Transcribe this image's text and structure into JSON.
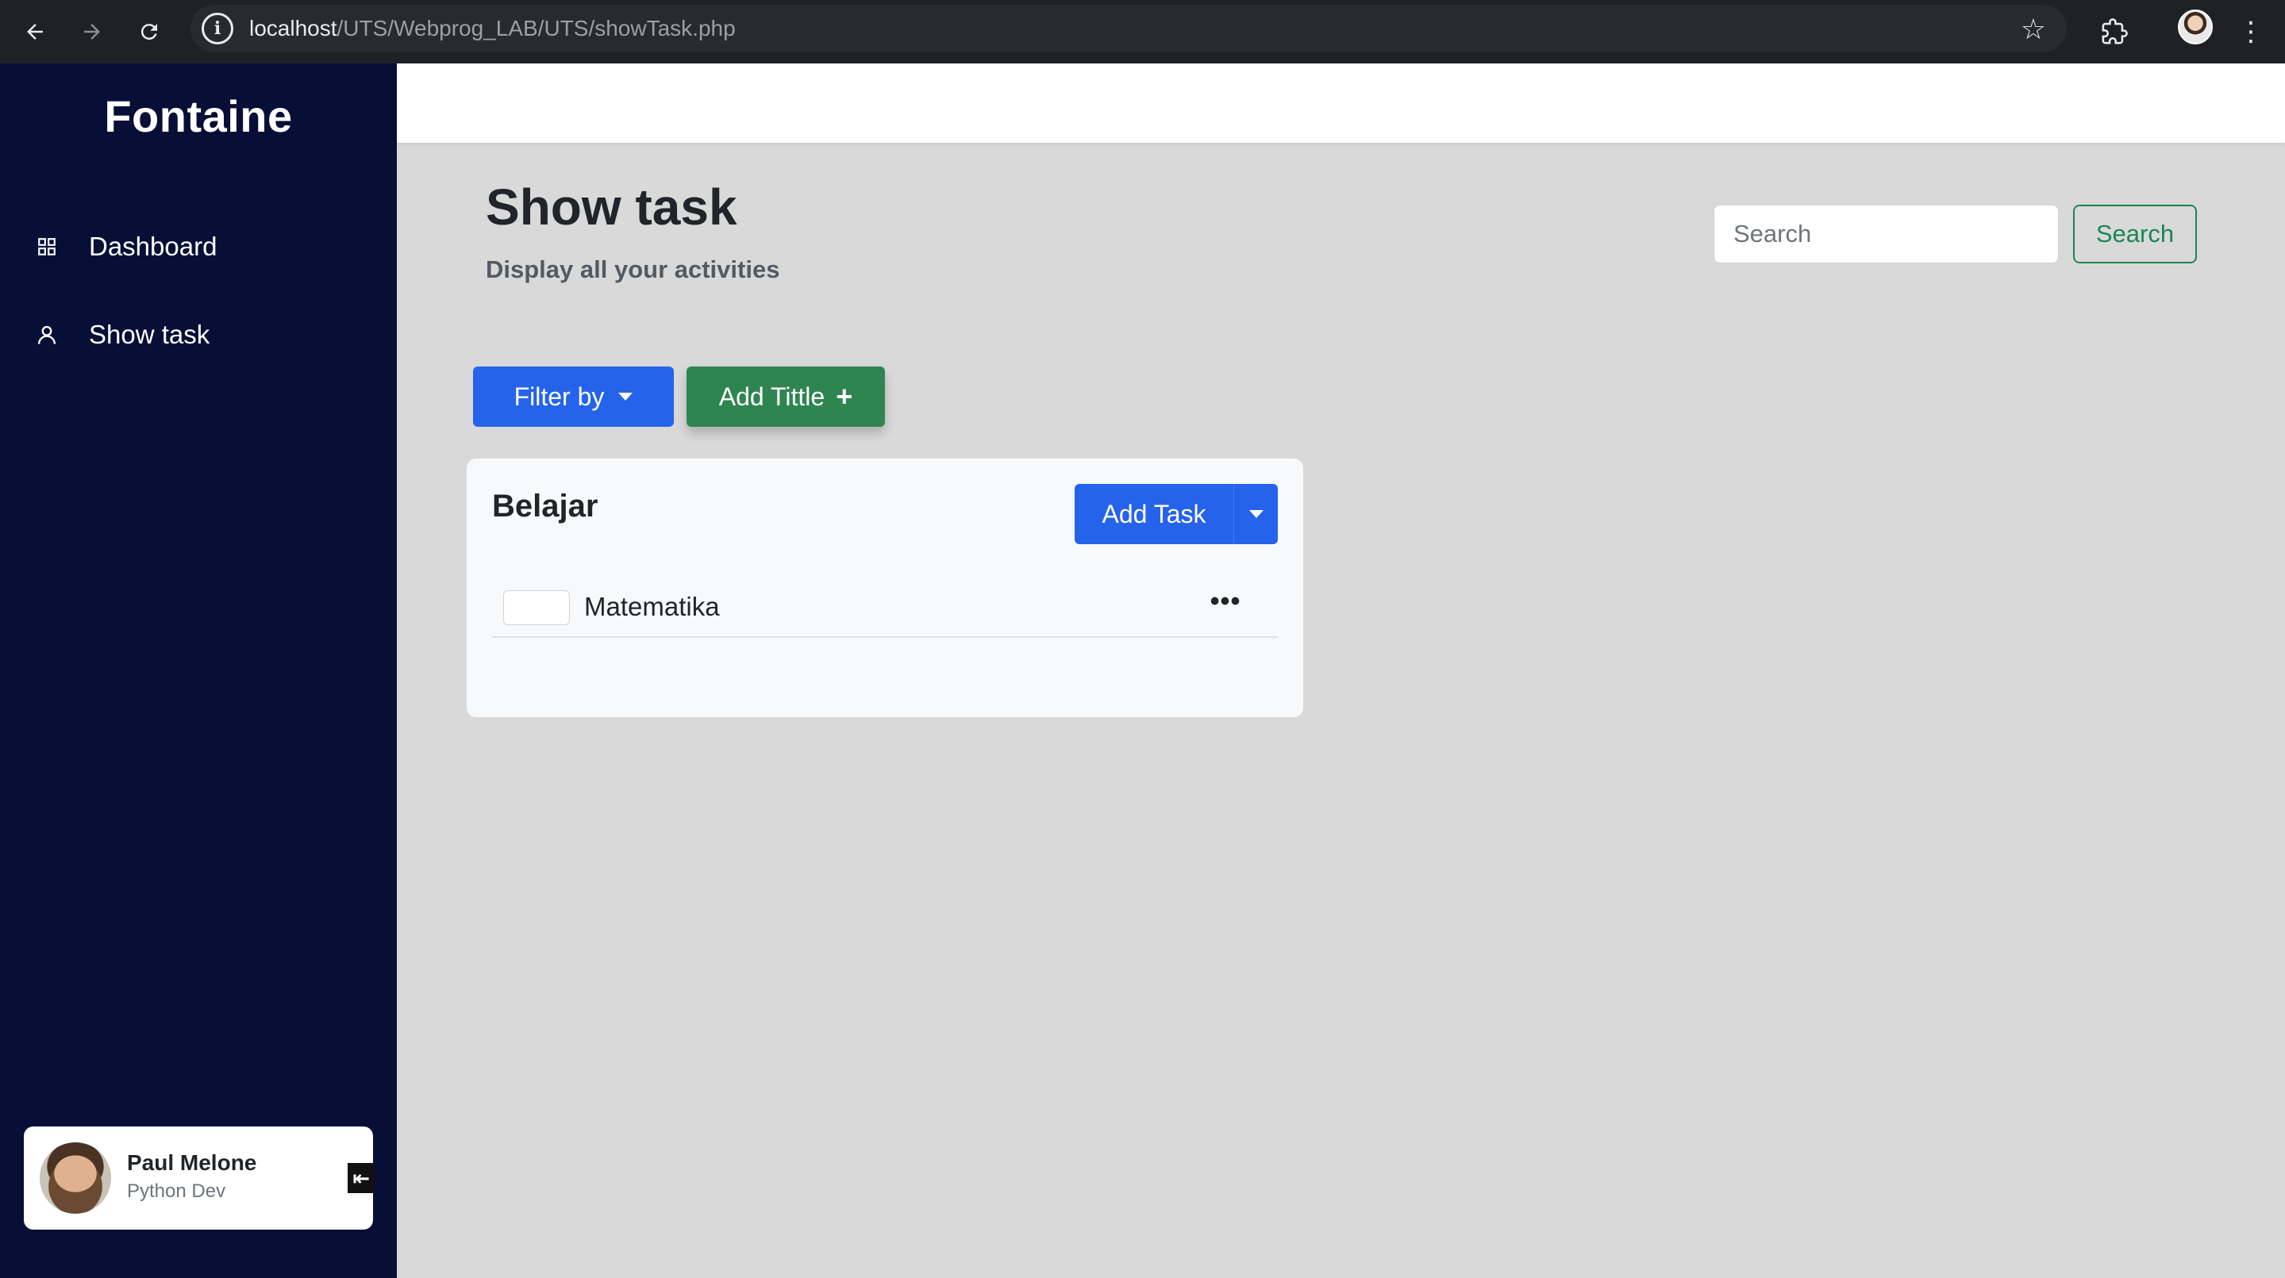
{
  "browser": {
    "url_host": "localhost",
    "url_path": "/UTS/Webprog_LAB/UTS/showTask.php"
  },
  "sidebar": {
    "brand": "Fontaine",
    "items": [
      {
        "label": "Dashboard",
        "icon": "grid-icon"
      },
      {
        "label": "Show task",
        "icon": "user-icon"
      }
    ],
    "user": {
      "name": "Paul Melone",
      "role": "Python Dev"
    }
  },
  "main": {
    "title": "Show task",
    "subtitle": "Display all your activities",
    "search": {
      "placeholder": "Search",
      "button_label": "Search"
    },
    "toolbar": {
      "filter_label": "Filter by",
      "add_title_label": "Add Tittle"
    },
    "card": {
      "title": "Belajar",
      "add_task_label": "Add Task",
      "tasks": [
        {
          "label": "Matematika"
        }
      ]
    }
  },
  "colors": {
    "sidebar_bg": "#080f36",
    "primary": "#2563eb",
    "success": "#2f8550",
    "page_bg": "#d9d9d9"
  }
}
